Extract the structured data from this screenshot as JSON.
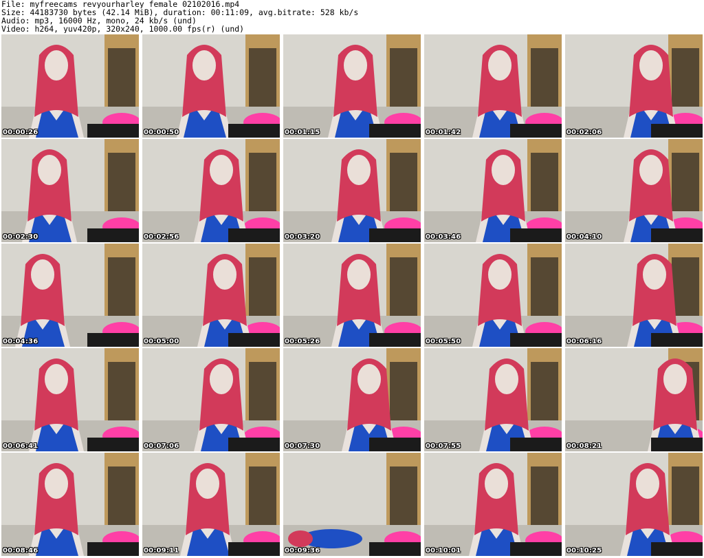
{
  "header": {
    "file_line": "File: myfreecams_revyourharley_female_02102016.mp4",
    "size_line": "Size: 44183730 bytes (42.14 MiB), duration: 00:11:09, avg.bitrate: 528 kb/s",
    "audio_line": "Audio: mp3, 16000 Hz, mono, 24 kb/s (und)",
    "video_line": "Video: h264, yuv420p, 320x240, 1000.00 fps(r) (und)"
  },
  "colors": {
    "dress_blue": "#1e4fc4",
    "hair_red": "#d23a5a",
    "pillow_pink": "#ff3fa6",
    "wall": "#d8d6cf",
    "shelf_wood": "#b88a3e"
  },
  "thumbnails": [
    {
      "timestamp": "00:00:26"
    },
    {
      "timestamp": "00:00:50"
    },
    {
      "timestamp": "00:01:15"
    },
    {
      "timestamp": "00:01:42"
    },
    {
      "timestamp": "00:02:06"
    },
    {
      "timestamp": "00:02:30"
    },
    {
      "timestamp": "00:02:56"
    },
    {
      "timestamp": "00:03:20"
    },
    {
      "timestamp": "00:03:46"
    },
    {
      "timestamp": "00:04:10"
    },
    {
      "timestamp": "00:04:36"
    },
    {
      "timestamp": "00:05:00"
    },
    {
      "timestamp": "00:05:26"
    },
    {
      "timestamp": "00:05:50"
    },
    {
      "timestamp": "00:06:16"
    },
    {
      "timestamp": "00:06:41"
    },
    {
      "timestamp": "00:07:06"
    },
    {
      "timestamp": "00:07:30"
    },
    {
      "timestamp": "00:07:55"
    },
    {
      "timestamp": "00:08:21"
    },
    {
      "timestamp": "00:08:46"
    },
    {
      "timestamp": "00:09:11"
    },
    {
      "timestamp": "00:09:36"
    },
    {
      "timestamp": "00:10:01"
    },
    {
      "timestamp": "00:10:25"
    }
  ]
}
